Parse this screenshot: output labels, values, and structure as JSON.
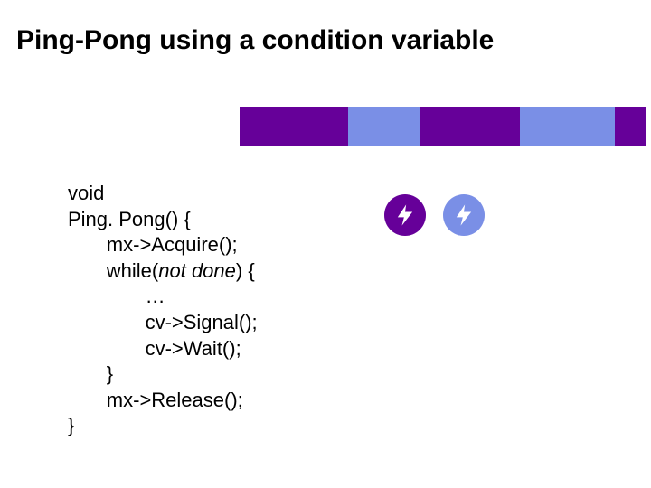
{
  "title": "Ping-Pong using a condition variable",
  "code": {
    "l1": "void",
    "l2": "Ping. Pong() {",
    "l3": "       mx->Acquire();",
    "l4_a": "       while(",
    "l4_b": "not done",
    "l4_c": ") {",
    "l5": "              …",
    "l6": "              cv->Signal();",
    "l7": "              cv->Wait();",
    "l8": "       }",
    "l9": "       mx->Release();",
    "l10": "}"
  },
  "icons": {
    "thread1": "lightning-icon",
    "thread2": "lightning-icon"
  },
  "colors": {
    "purple": "#660099",
    "blue": "#7A8FE6"
  }
}
